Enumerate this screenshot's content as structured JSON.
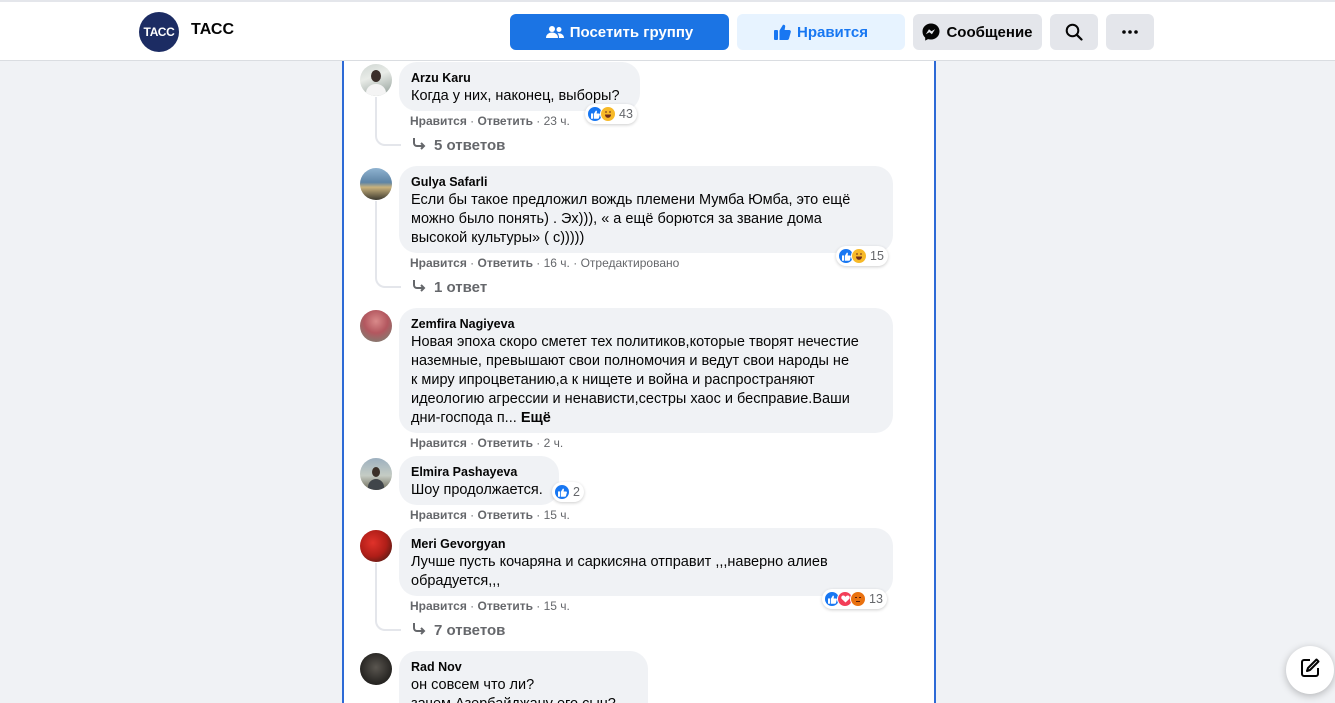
{
  "header": {
    "logo_text": "ТАСС",
    "page_name": "ТАСС",
    "visit_group_label": "Посетить группу",
    "like_label": "Нравится",
    "message_label": "Сообщение"
  },
  "colors": {
    "brand": "#1b74e4",
    "like": "#1877f2",
    "feed_border": "#2d6ad6"
  },
  "comments": [
    {
      "author": "Arzu Karu",
      "text": "Когда у них, наконец, выборы?",
      "like": "Нравится",
      "reply": "Ответить",
      "time": "23 ч.",
      "reactions": 43,
      "reaction_types": [
        "like-icon",
        "haha-icon"
      ],
      "replies_label": "5 ответов"
    },
    {
      "author": "Gulya Safarli",
      "text": "Если бы такое предложил вождь племени Мумба Юмба, это ещё\nможно было понять) . Эх))), « а ещё борются за звание дома\nвысокой культуры» ( с)))))",
      "like": "Нравится",
      "reply": "Ответить",
      "time": "16 ч.",
      "edited": "Отредактировано",
      "reactions": 15,
      "reaction_types": [
        "like-icon",
        "haha-icon"
      ],
      "replies_label": "1 ответ"
    },
    {
      "author": "Zemfira Nagiyeva",
      "text": "Новая эпоха скоро сметет тех политиков,которые творят нечестие\nназемные, превышают свои полномочия и ведут свои народы не\nк миру ипроцветанию,а к нищете и война и распространяют\nидеологию агрессии и ненависти,сестры хаос и бесправие.Ваши\nдни-господа п...",
      "more": "Ещё",
      "like": "Нравится",
      "reply": "Ответить",
      "time": "2 ч."
    },
    {
      "author": "Elmira Pashayeva",
      "text": "Шоу продолжается.",
      "like": "Нравится",
      "reply": "Ответить",
      "time": "15 ч.",
      "reactions": 2,
      "reaction_types": [
        "like-icon"
      ]
    },
    {
      "author": "Meri Gevorgyan",
      "text": "Лучше пусть кочаряна и саркисяна отправит ,,,наверно алиев\nобрадуется,,,",
      "like": "Нравится",
      "reply": "Ответить",
      "time": "15 ч.",
      "reactions": 13,
      "reaction_types": [
        "like-icon",
        "love-icon",
        "angry-icon"
      ],
      "replies_label": "7 ответов"
    },
    {
      "author": "Rad Nov",
      "text": "он совсем что ли?\nзачем Азербайджану его сын?"
    }
  ],
  "icons": {
    "visit": "group-icon",
    "like": "thumbs-up-icon",
    "message": "messenger-icon",
    "search": "search-icon",
    "more": "more-dots-icon",
    "fab": "compose-icon",
    "reply_arrow": "reply-arrow-icon"
  }
}
